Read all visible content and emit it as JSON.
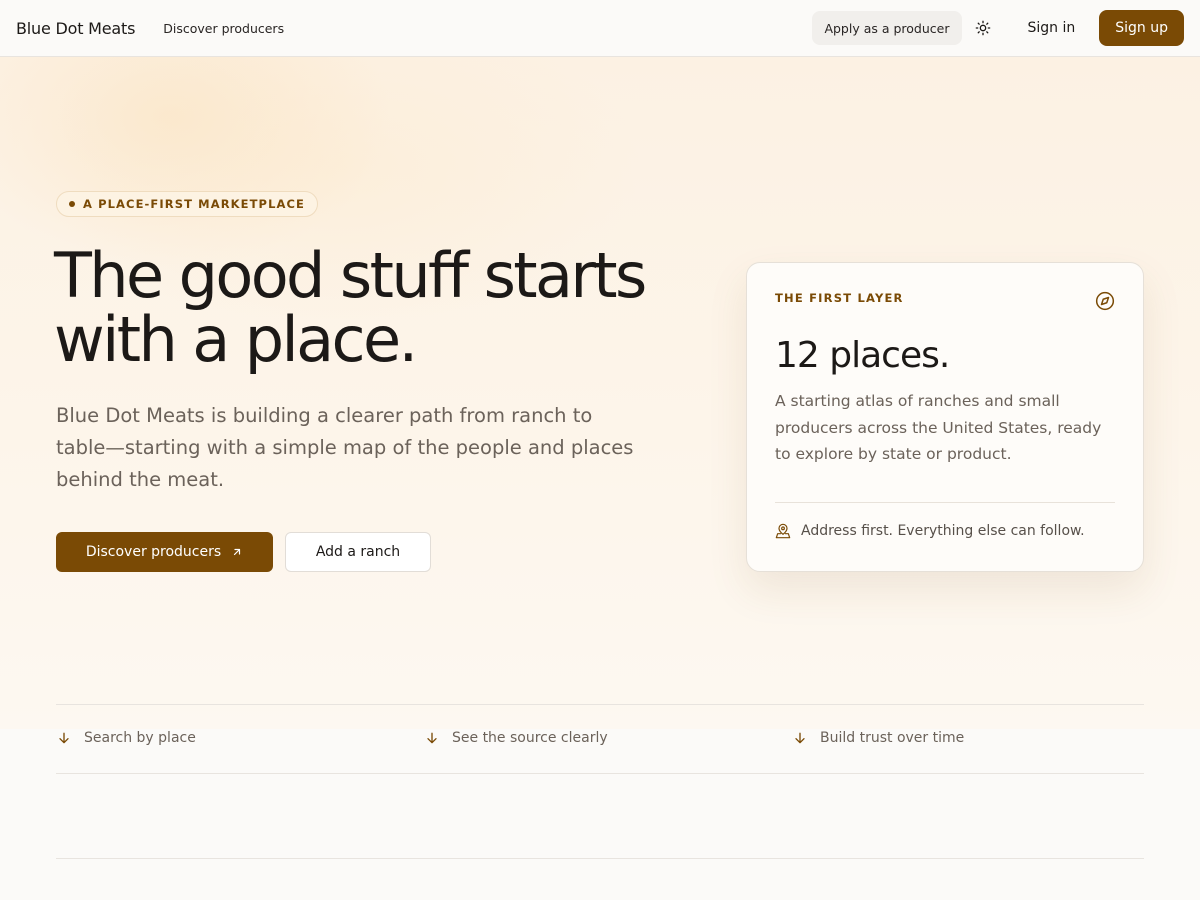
{
  "nav": {
    "brand": "Blue Dot Meats",
    "discover_link": "Discover producers",
    "apply_label": "Apply as a producer",
    "signin_label": "Sign in",
    "signup_label": "Sign up",
    "theme_icon": "sun-icon"
  },
  "hero": {
    "badge": "A PLACE-FIRST MARKETPLACE",
    "headline": "The good stuff starts with a place.",
    "subtext": "Blue Dot Meats is building a clearer path from ranch to table—starting with a simple map of the people and places behind the meat.",
    "primary_cta": "Discover producers",
    "secondary_cta": "Add a ranch"
  },
  "card": {
    "eyebrow": "THE FIRST LAYER",
    "title": "12 places.",
    "body": "A starting atlas of ranches and small producers across the United States, ready to explore by state or product.",
    "footnote": "Address first. Everything else can follow."
  },
  "features": [
    {
      "label": "Search by place"
    },
    {
      "label": "See the source clearly"
    },
    {
      "label": "Build trust over time"
    }
  ],
  "colors": {
    "accent": "#7a4a05",
    "text": "#1c1917",
    "muted": "#6b625a",
    "background": "#fbfaf8"
  }
}
